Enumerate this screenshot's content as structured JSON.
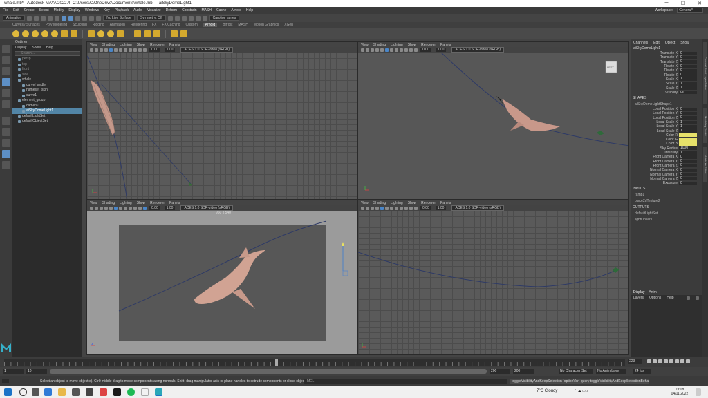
{
  "window": {
    "title": "whale.mb* - Autodesk MAYA 2022.4: C:\\Users\\C\\OneDrive\\Documents\\whale.mb  ---  aiSkyDomeLight1",
    "controls": [
      "─",
      "☐",
      "✕"
    ]
  },
  "menubar": {
    "items": [
      "File",
      "Edit",
      "Create",
      "Select",
      "Modify",
      "Display",
      "Windows",
      "Key",
      "Playback",
      "Audio",
      "Visualize",
      "Deform",
      "Constrain",
      "MASH",
      "Cache",
      "Arnold",
      "Help"
    ],
    "workspace_label": "Workspace:",
    "workspace_value": "General*"
  },
  "statusline": {
    "menuset": "Animation",
    "surface": "No Live Surface",
    "symmetry": "Symmetry: Off",
    "user": "Caroline Iames"
  },
  "shelf": {
    "tabs": [
      "Curves / Surfaces",
      "Poly Modeling",
      "Sculpting",
      "Rigging",
      "Animation",
      "Rendering",
      "FX",
      "FX Caching",
      "Custom",
      "Arnold",
      "Bifrost",
      "MASH",
      "Motion Graphics",
      "XGen"
    ],
    "active_tab": "Arnold"
  },
  "outliner": {
    "title": "Outliner",
    "menu": [
      "Display",
      "Show",
      "Help"
    ],
    "search_placeholder": "Search...",
    "items": [
      {
        "label": "persp",
        "dim": true,
        "indent": 0
      },
      {
        "label": "top",
        "dim": true,
        "indent": 0
      },
      {
        "label": "front",
        "dim": true,
        "indent": 0
      },
      {
        "label": "side",
        "dim": true,
        "indent": 0
      },
      {
        "label": "whale",
        "dim": false,
        "indent": 0
      },
      {
        "label": "curveHandle",
        "dim": false,
        "indent": 1
      },
      {
        "label": "nameset_skin",
        "dim": false,
        "indent": 1
      },
      {
        "label": "curve1",
        "dim": false,
        "indent": 1
      },
      {
        "label": "element_group",
        "dim": false,
        "indent": 0
      },
      {
        "label": "cameraT",
        "dim": false,
        "indent": 1
      },
      {
        "label": "aiSkyDomeLight1",
        "dim": false,
        "indent": 1,
        "selected": true
      },
      {
        "label": "defaultLightSet",
        "dim": false,
        "indent": 0
      },
      {
        "label": "defaultObjectSet",
        "dim": false,
        "indent": 0
      }
    ]
  },
  "viewport": {
    "menu": [
      "View",
      "Shading",
      "Lighting",
      "Show",
      "Renderer",
      "Panels"
    ],
    "field_a": "0.00",
    "field_b": "1.00",
    "colorspace": "ACES 1.0 SDR-video (sRGB)",
    "resolution_label": "960 x 540",
    "viewcube_label": "LEFT"
  },
  "channelbox": {
    "menu": [
      "Channels",
      "Edit",
      "Object",
      "Show"
    ],
    "object": "aiSkyDomeLight1",
    "transform": [
      {
        "label": "Translate X",
        "value": "0"
      },
      {
        "label": "Translate Y",
        "value": "0"
      },
      {
        "label": "Translate Z",
        "value": "0"
      },
      {
        "label": "Rotate X",
        "value": "0"
      },
      {
        "label": "Rotate Y",
        "value": "0"
      },
      {
        "label": "Rotate Z",
        "value": "0"
      },
      {
        "label": "Scale X",
        "value": "1"
      },
      {
        "label": "Scale Y",
        "value": "1"
      },
      {
        "label": "Scale Z",
        "value": "1"
      },
      {
        "label": "Visibility",
        "value": "on"
      }
    ],
    "shapes_label": "SHAPES",
    "shape_name": "aiSkyDomeLightShape1",
    "shape": [
      {
        "label": "Local Position X",
        "value": "0"
      },
      {
        "label": "Local Position Y",
        "value": "0"
      },
      {
        "label": "Local Position Z",
        "value": "0"
      },
      {
        "label": "Local Scale X",
        "value": "1"
      },
      {
        "label": "Local Scale Y",
        "value": "1"
      },
      {
        "label": "Local Scale Z",
        "value": "1"
      },
      {
        "label": "Color R",
        "value": "",
        "yellow": true
      },
      {
        "label": "Color G",
        "value": "",
        "yellow": true
      },
      {
        "label": "Color B",
        "value": "",
        "yellow": true
      },
      {
        "label": "Sky Radius",
        "value": "1000"
      },
      {
        "label": "Intensity",
        "value": "1"
      },
      {
        "label": "Front Camera X",
        "value": "0"
      },
      {
        "label": "Front Camera Y",
        "value": "0"
      },
      {
        "label": "Front Camera Z",
        "value": "0"
      },
      {
        "label": "Normal Camera X",
        "value": "0"
      },
      {
        "label": "Normal Camera Y",
        "value": "0"
      },
      {
        "label": "Normal Camera Z",
        "value": "0"
      },
      {
        "label": "Exposure",
        "value": "0"
      }
    ],
    "inputs_label": "INPUTS",
    "inputs": [
      "ramp1",
      "place2dTexture2"
    ],
    "outputs_label": "OUTPUTS",
    "outputs": [
      "defaultLightSet",
      "lightLinker1"
    ]
  },
  "layers": {
    "tabs": [
      "Display",
      "Anim"
    ],
    "menu": [
      "Layers",
      "Options",
      "Help"
    ]
  },
  "sidetabs": [
    "Channel Box / Layer Editor",
    "Modeling Toolkit",
    "Attribute Editor"
  ],
  "timeslider": {
    "current_frame": "223"
  },
  "rangeslider": {
    "start": "1",
    "start_inner": "10",
    "end_inner": "200",
    "end": "200",
    "character_set": "No Character Set",
    "anim_layer": "No Anim Layer",
    "fps": "24 fps"
  },
  "commandline": {
    "help_text": "Select an object to move object(s). Ctrl+middle drag to move components along normals. Shift+drag manipulator axis or plane handles to extrude components or clone objects. Ctrl+Shift+drag to constrain movement to a co",
    "mel_label": "MEL",
    "result": "toggleVisibilityAndKeepSelection `optionVar -query toggleVisibilityAndKeepSelectionBehaviour`;"
  },
  "taskbar": {
    "weather": "7°C  Cloudy",
    "time": "23:08",
    "date": "04/11/2022"
  }
}
